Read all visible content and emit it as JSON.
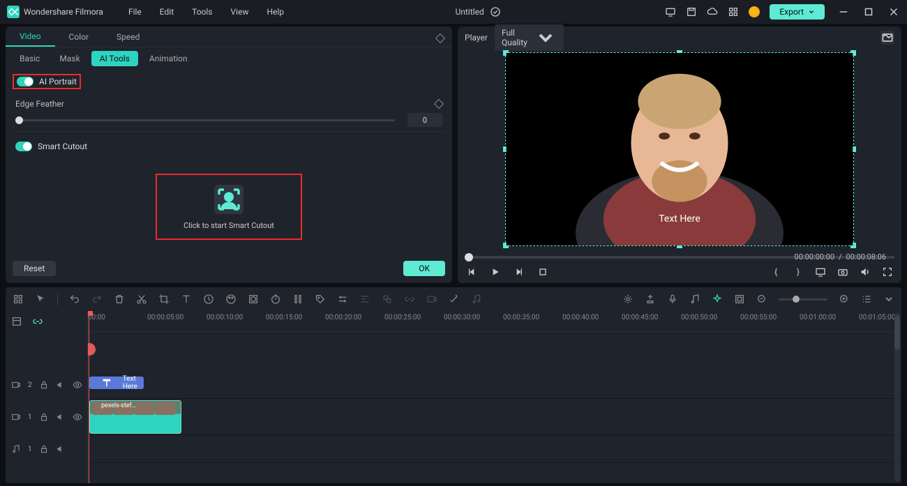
{
  "app": {
    "name": "Wondershare Filmora",
    "doc_title": "Untitled"
  },
  "menu": [
    "File",
    "Edit",
    "Tools",
    "View",
    "Help"
  ],
  "export_label": "Export",
  "tabs_top": [
    "Video",
    "Color",
    "Speed"
  ],
  "tabs_top_active": 0,
  "tabs_sub": [
    "Basic",
    "Mask",
    "AI Tools",
    "Animation"
  ],
  "tabs_sub_active": 2,
  "panel": {
    "ai_portrait_label": "AI Portrait",
    "edge_feather_label": "Edge Feather",
    "edge_feather_value": "0",
    "smart_cutout_label": "Smart Cutout",
    "smart_cutout_hint": "Click to start Smart Cutout",
    "reset_label": "Reset",
    "ok_label": "OK"
  },
  "player": {
    "label": "Player",
    "quality": "Full Quality",
    "text_overlay": "Text Here",
    "time_current": "00:00:00:00",
    "time_sep": "/",
    "time_total": "00:00:08:06"
  },
  "timeline": {
    "ruler": [
      "00:00",
      "00:00:05:00",
      "00:00:10:00",
      "00:00:15:00",
      "00:00:20:00",
      "00:00:25:00",
      "00:00:30:00",
      "00:00:35:00",
      "00:00:40:00",
      "00:00:45:00",
      "00:00:50:00",
      "00:00:55:00",
      "00:01:00:00",
      "00:01:05:00"
    ],
    "tracks": [
      {
        "id": "video2",
        "icon": "video-icon",
        "num": "2"
      },
      {
        "id": "video1",
        "icon": "video-icon",
        "num": "1"
      },
      {
        "id": "audio1",
        "icon": "audio-icon",
        "num": "1"
      }
    ],
    "text_clip_label": "Text Here",
    "video_clip_label": "pexels-stef…"
  }
}
